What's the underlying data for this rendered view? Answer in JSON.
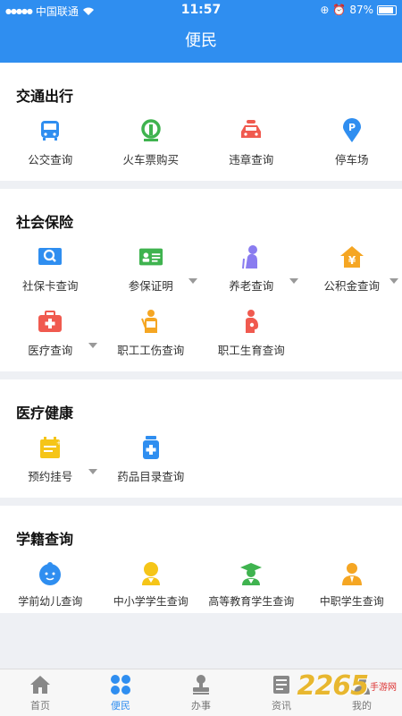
{
  "status_bar": {
    "carrier": "中国联通",
    "time": "11:57",
    "battery": "87%"
  },
  "header": {
    "title": "便民"
  },
  "sections": {
    "traffic": {
      "title": "交通出行",
      "items": [
        {
          "label": "公交查询",
          "icon": "bus-icon"
        },
        {
          "label": "火车票购买",
          "icon": "train-icon"
        },
        {
          "label": "违章查询",
          "icon": "police-car-icon"
        },
        {
          "label": "停车场",
          "icon": "parking-pin-icon"
        }
      ]
    },
    "insurance": {
      "title": "社会保险",
      "items": [
        {
          "label": "社保卡查询",
          "icon": "card-search-icon"
        },
        {
          "label": "参保证明",
          "icon": "id-card-icon"
        },
        {
          "label": "养老查询",
          "icon": "elderly-icon"
        },
        {
          "label": "公积金查询",
          "icon": "house-yuan-icon"
        },
        {
          "label": "医疗查询",
          "icon": "medical-kit-icon"
        },
        {
          "label": "职工工伤查询",
          "icon": "injury-icon"
        },
        {
          "label": "职工生育查询",
          "icon": "maternity-icon"
        }
      ]
    },
    "health": {
      "title": "医疗健康",
      "items": [
        {
          "label": "预约挂号",
          "icon": "calendar-icon"
        },
        {
          "label": "药品目录查询",
          "icon": "medicine-bottle-icon"
        }
      ]
    },
    "education": {
      "title": "学籍查询",
      "items": [
        {
          "label": "学前幼儿查询",
          "icon": "baby-icon"
        },
        {
          "label": "中小学学生查询",
          "icon": "student-icon"
        },
        {
          "label": "高等教育学生查询",
          "icon": "graduate-icon"
        },
        {
          "label": "中职学生查询",
          "icon": "vocational-icon"
        }
      ]
    }
  },
  "tabbar": {
    "tabs": [
      {
        "label": "首页",
        "icon": "home-icon"
      },
      {
        "label": "便民",
        "icon": "grid-icon"
      },
      {
        "label": "办事",
        "icon": "stamp-icon"
      },
      {
        "label": "资讯",
        "icon": "news-icon"
      },
      {
        "label": "我的",
        "icon": "person-icon"
      }
    ]
  },
  "watermark": {
    "text": "2265",
    "sub": "手游网"
  },
  "colors": {
    "primary": "#2f8ef0",
    "green": "#3fb34f",
    "red": "#f05a4f",
    "orange": "#f5a623",
    "purple": "#8a7cf0",
    "yellow": "#f5c518"
  }
}
